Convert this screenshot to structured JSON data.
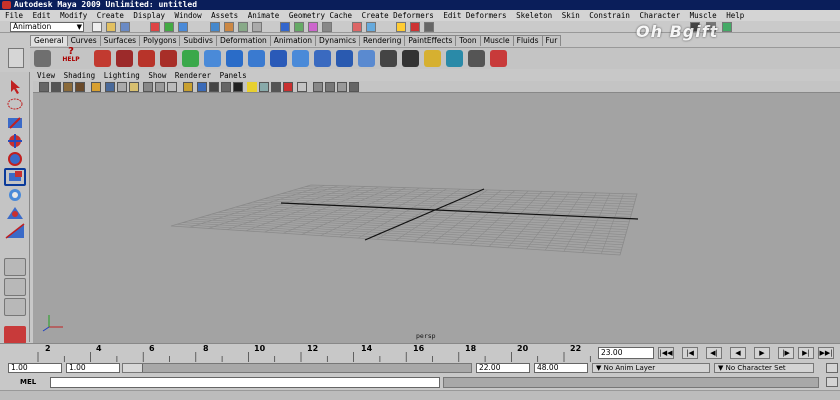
{
  "window": {
    "title": "Autodesk Maya 2009 Unlimited: untitled"
  },
  "menubar": {
    "items": [
      "File",
      "Edit",
      "Modify",
      "Create",
      "Display",
      "Window",
      "Assets",
      "Animate",
      "Geometry Cache",
      "Create Deformers",
      "Edit Deformers",
      "Skeleton",
      "Skin",
      "Constrain",
      "Character",
      "Muscle",
      "Help"
    ]
  },
  "statusline": {
    "mode": "Animation"
  },
  "shelf": {
    "tabs": [
      "General",
      "Curves",
      "Surfaces",
      "Polygons",
      "Subdivs",
      "Deformation",
      "Animation",
      "Dynamics",
      "Rendering",
      "PaintEffects",
      "Toon",
      "Muscle",
      "Fluids",
      "Fur"
    ],
    "active_tab": "General",
    "help_label": "HELP"
  },
  "viewport": {
    "menus": [
      "View",
      "Shading",
      "Lighting",
      "Show",
      "Renderer",
      "Panels"
    ],
    "camera": "persp"
  },
  "timeline": {
    "ticks": [
      "2",
      "4",
      "6",
      "8",
      "10",
      "12",
      "14",
      "16",
      "18",
      "20",
      "22"
    ],
    "current_frame": "23.00"
  },
  "range": {
    "start_time": "1.00",
    "playback_start": "1.00",
    "playback_end": "22.00",
    "end_time": "48.00",
    "anim_layer": "No Anim Layer",
    "character_set": "No Character Set"
  },
  "cmdline": {
    "label": "MEL"
  },
  "watermark": {
    "text": "Oh Bgift"
  }
}
